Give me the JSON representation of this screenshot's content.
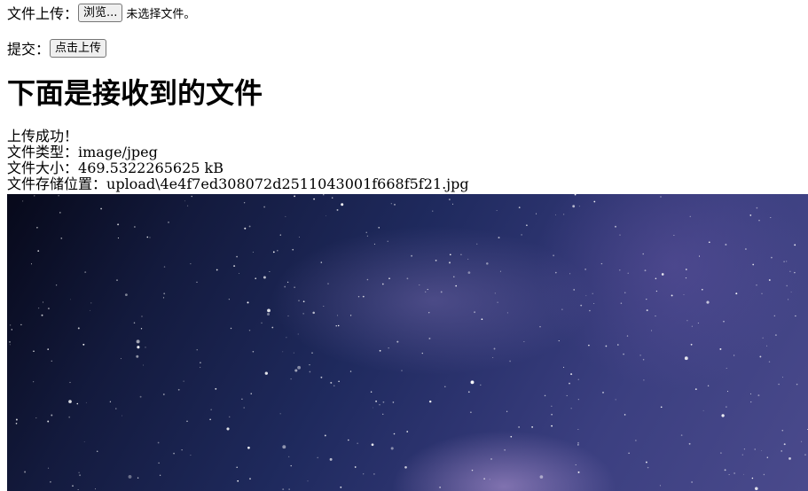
{
  "form": {
    "file_label": "文件上传：",
    "browse_button": "浏览...",
    "no_file_text": "未选择文件。",
    "submit_label": "提交：",
    "submit_button": "点击上传"
  },
  "result": {
    "heading": "下面是接收到的文件",
    "status": "上传成功！",
    "type_label": "文件类型：",
    "type_value": "image/jpeg",
    "size_label": "文件大小：",
    "size_value": "469.5322265625 kB",
    "path_label": "文件存储位置：",
    "path_value": "upload\\4e4f7ed308072d2511043001f668f5f21.jpg"
  },
  "image": {
    "description_name": "uploaded-starry-sky-image"
  }
}
